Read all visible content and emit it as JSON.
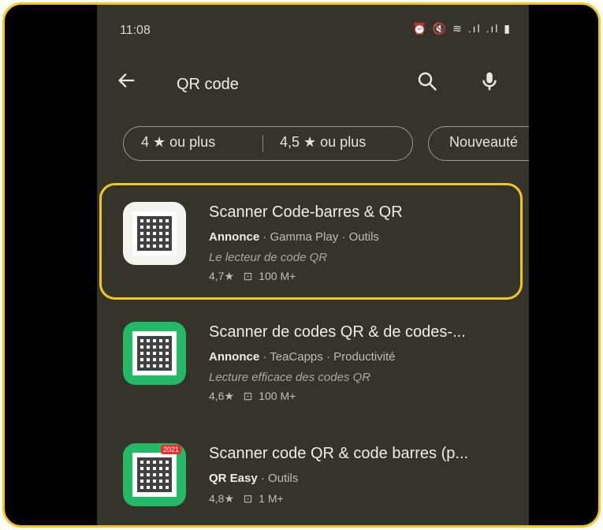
{
  "status_bar": {
    "time": "11:08",
    "icons": "⏰ 🔇 ≋ .ıl .ıl ▮"
  },
  "search": {
    "query": "QR code"
  },
  "filters": [
    {
      "label": "4 ★ ou plus"
    },
    {
      "label": "4,5 ★ ou plus"
    },
    {
      "label": "Nouveauté"
    }
  ],
  "results": [
    {
      "name": "Scanner Code-barres & QR",
      "ad_label": "Annonce",
      "developer": "Gamma Play",
      "category": "Outils",
      "description": "Le lecteur de code QR",
      "rating": "4,7★",
      "downloads": "100 M+"
    },
    {
      "name": "Scanner de codes QR & de codes-...",
      "ad_label": "Annonce",
      "developer": "TeaCapps",
      "category": "Productivité",
      "description": "Lecture efficace des codes QR",
      "rating": "4,6★",
      "downloads": "100 M+"
    },
    {
      "name": "Scanner code QR & code barres (p...",
      "developer": "QR Easy",
      "category": "Outils",
      "rating": "4,8★",
      "downloads": "1 M+",
      "icon_badge": "2021"
    }
  ],
  "colors": {
    "highlight": "#f2c81f",
    "background": "#34342b",
    "icon_green": "#25b866"
  }
}
